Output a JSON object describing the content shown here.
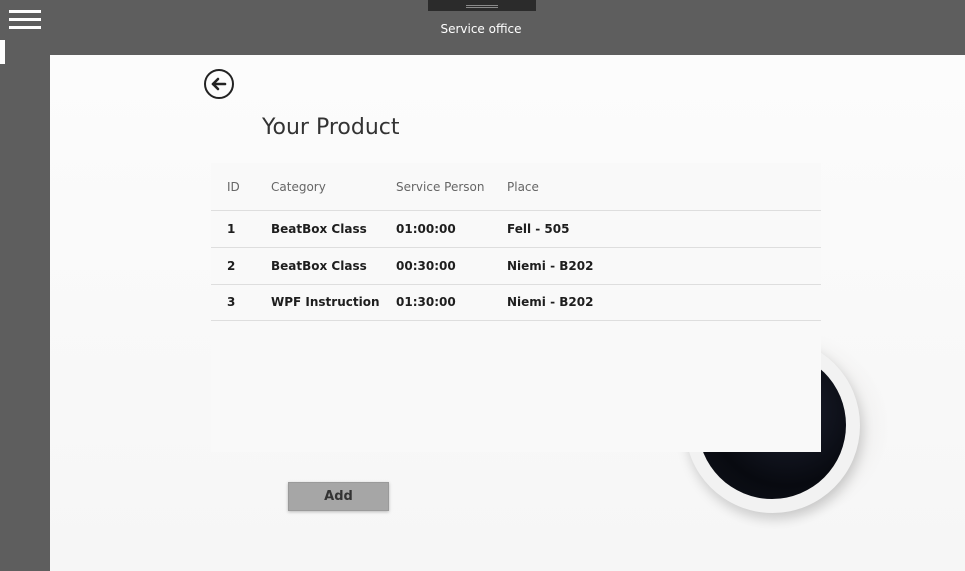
{
  "app": {
    "title": "Service office"
  },
  "page": {
    "title": "Your Product"
  },
  "table": {
    "columns": [
      "ID",
      "Category",
      "Service Person",
      "Place"
    ],
    "rows": [
      [
        "1",
        "BeatBox Class",
        "01:00:00",
        "Fell - 505"
      ],
      [
        "2",
        "BeatBox Class",
        "00:30:00",
        "Niemi - B202"
      ],
      [
        "3",
        "WPF Instruction",
        "01:30:00",
        "Niemi - B202"
      ]
    ]
  },
  "actions": {
    "add_label": "Add"
  },
  "icons": {
    "menu": "hamburger-menu-icon",
    "back": "back-arrow-icon"
  },
  "colors": {
    "chrome": "#5e5e5e",
    "accent": "#ffffff",
    "button": "#a6a6a6"
  }
}
